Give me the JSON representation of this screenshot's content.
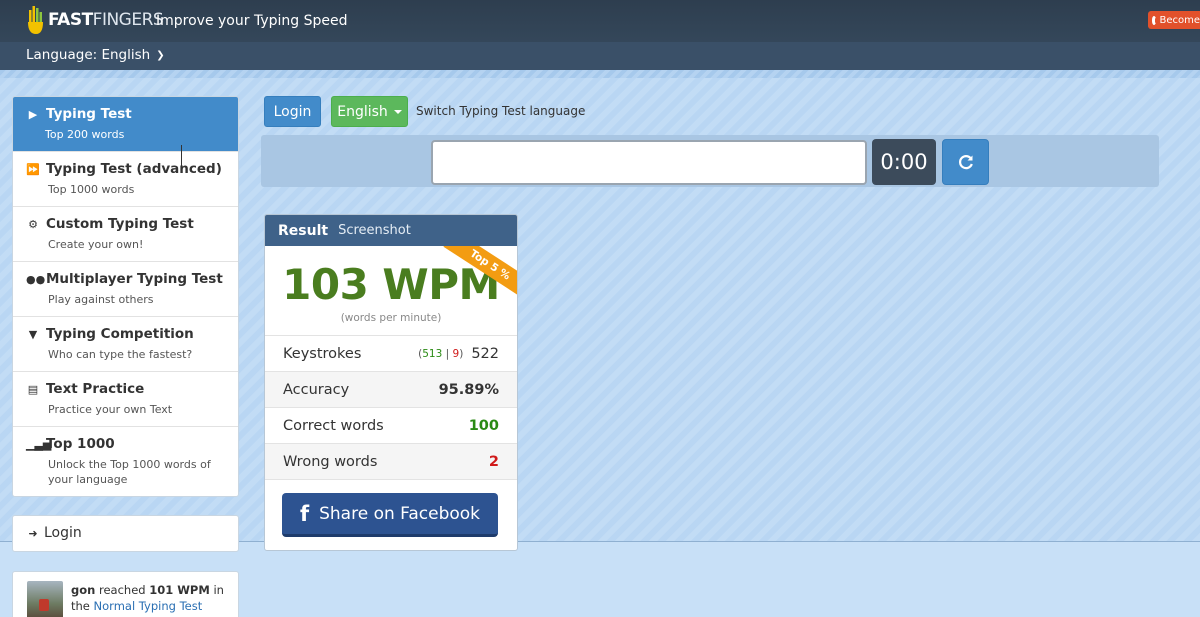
{
  "header": {
    "logo": {
      "part1": "FAST",
      "part2": "FINGERS"
    },
    "tagline": "Improve your Typing Speed",
    "become_label": "Become"
  },
  "language_bar": {
    "label": "Language: English"
  },
  "sidebar": {
    "items": [
      {
        "title": "Typing Test",
        "sub": "Top 200 words",
        "icon": "play-icon"
      },
      {
        "title": "Typing Test (advanced)",
        "sub": "Top 1000 words",
        "icon": "fast-forward-icon"
      },
      {
        "title": "Custom Typing Test",
        "sub": "Create your own!",
        "icon": "gears-icon"
      },
      {
        "title": "Multiplayer Typing Test",
        "sub": "Play against others",
        "icon": "users-icon"
      },
      {
        "title": "Typing Competition",
        "sub": "Who can type the fastest?",
        "icon": "trophy-icon"
      },
      {
        "title": "Text Practice",
        "sub": "Practice your own Text",
        "icon": "file-icon"
      },
      {
        "title": "Top 1000",
        "sub": "Unlock the Top 1000 words of your language",
        "icon": "signal-icon"
      }
    ],
    "login_label": "Login",
    "feed": {
      "user": "gon",
      "text1": "reached",
      "wpm": "101 WPM",
      "text2": "in",
      "text3": "the",
      "link": "Normal Typing Test"
    }
  },
  "controls": {
    "login_label": "Login",
    "language_label": "English",
    "switch_label": "Switch Typing Test language",
    "input_value": "",
    "timer": "0:00"
  },
  "result": {
    "title": "Result",
    "screenshot_label": "Screenshot",
    "ribbon": "Top 5 %",
    "wpm": "103 WPM",
    "wpm_sub": "(words per minute)",
    "keystrokes": {
      "label": "Keystrokes",
      "correct": "513",
      "sep": "|",
      "wrong": "9",
      "total": "522"
    },
    "accuracy": {
      "label": "Accuracy",
      "value": "95.89%"
    },
    "correct_words": {
      "label": "Correct words",
      "value": "100"
    },
    "wrong_words": {
      "label": "Wrong words",
      "value": "2"
    },
    "facebook_label": "Share on Facebook"
  },
  "colors": {
    "header_bg": "#2e3e4f",
    "accent_blue": "#428bca",
    "accent_green": "#5cb85c",
    "wpm_green": "#4a7d1f",
    "facebook": "#2d5391",
    "ribbon": "#f39c12"
  }
}
